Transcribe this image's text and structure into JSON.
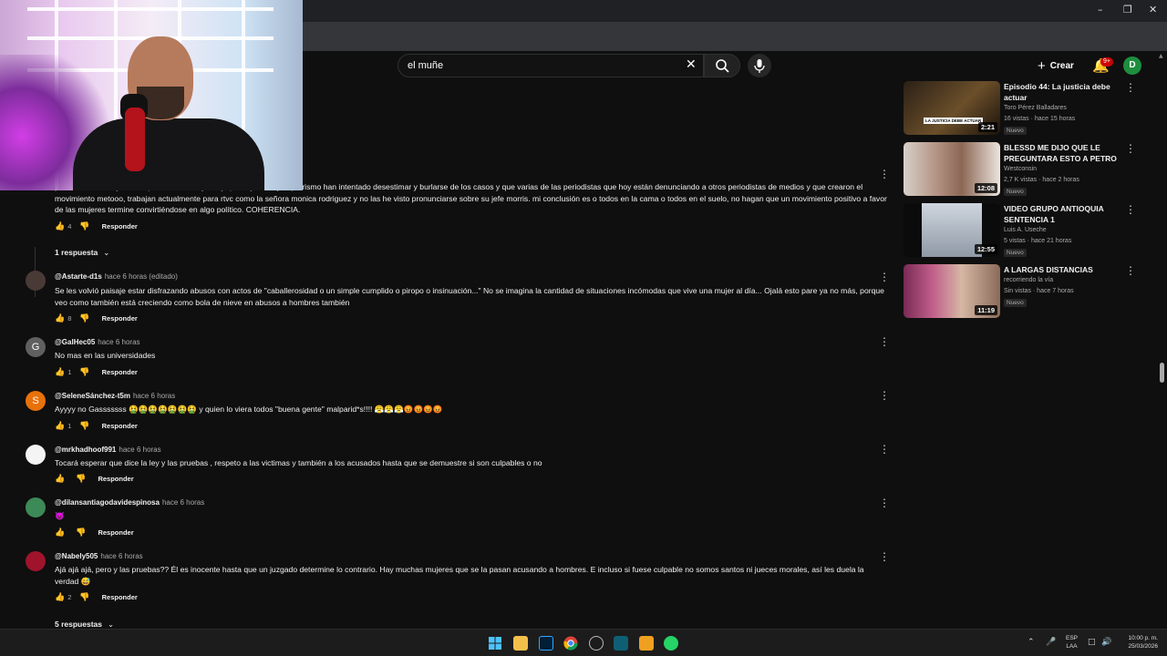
{
  "search": {
    "query": "el muñe"
  },
  "header": {
    "create_label": "Crear",
    "notif_badge": "9+",
    "user_initial": "D"
  },
  "comments": [
    {
      "text": "por acoso sexual y laboral por muchas mujeres y que la justicia y el petrismo han intentado desestimar y burlarse de los casos y que varias de las periodistas que hoy están denunciando a otros periodistas de medios y que crearon el movimiento metooo, trabajan actualmente para rtvc como la señora monica rodriguez y no las he visto pronunciarse sobre su jefe morris. mi conclusión es o todos en la cama o todos en el suelo, no hagan que un movimiento positivo a favor de las mujeres termine convirtiéndose en algo político. COHERENCIA.",
      "likes": "4",
      "reply_label": "Responder"
    },
    {
      "author": "@Astarte-d1s",
      "time": "hace 6 horas (editado)",
      "text": "Se les volvió paisaje estar disfrazando abusos con actos de \"caballerosidad o un simple cumplido o piropo o insinuación...\"  No se imagina la cantidad de situaciones incómodas que vive una mujer al día... Ojalá esto pare ya no más, porque veo como también está creciendo como bola de nieve en abusos a hombres también",
      "likes": "8",
      "reply_label": "Responder"
    },
    {
      "author": "@GalHec05",
      "time": "hace 6 horas",
      "text": "No mas en las universidades",
      "likes": "1",
      "reply_label": "Responder",
      "avatar_letter": "G"
    },
    {
      "author": "@SeleneSánchez-t5m",
      "time": "hace 6 horas",
      "text": "Ayyyy no Gasssssss 🤮🤮🤮🤮🤮🤮🤮 y quien lo viera todos \"buena gente\" malparid*s!!!! 😤😤😤😡😡😡😡",
      "likes": "1",
      "reply_label": "Responder",
      "avatar_letter": "S"
    },
    {
      "author": "@mrkhadhoof991",
      "time": "hace 6 horas",
      "text": "Tocará esperar que dice la ley y las pruebas , respeto a las victimas y también a los acusados hasta que se demuestre si son culpables o no",
      "reply_label": "Responder"
    },
    {
      "author": "@dilansantiagodavidespinosa",
      "time": "hace 6 horas",
      "text": "👿",
      "reply_label": "Responder"
    },
    {
      "author": "@Nabely505",
      "time": "hace 6 horas",
      "text": "Ajá ajá ajá, pero y las pruebas?? Él es inocente hasta que un juzgado determine lo contrario. Hay muchas mujeres que se la pasan acusando a hombres. E incluso si fuese culpable no somos santos ni jueces morales, así les duela la verdad 😅",
      "likes": "2",
      "reply_label": "Responder"
    }
  ],
  "replies": [
    {
      "label": "1 respuesta"
    },
    {
      "label": "5 respuestas"
    }
  ],
  "sidebar": [
    {
      "title": "Episodio 44: La justicia debe actuar",
      "channel": "Toro Pérez Balladares",
      "views": "16 vistas · hace 15 horas",
      "badge": "Nuevo",
      "duration": "2:21",
      "thumb_text": "LA JUSTICIA DEBE ACTUAR"
    },
    {
      "title": "BLESSD ME DIJO QUE LE PREGUNTARA ESTO A PETRO ...",
      "channel": "Westconsin",
      "views": "2,7 K vistas · hace 2 horas",
      "badge": "Nuevo",
      "duration": "12:08"
    },
    {
      "title": "VIDEO GRUPO ANTIOQUIA SENTENCIA 1",
      "channel": "Luis A. Useche",
      "views": "5 vistas · hace 21 horas",
      "badge": "Nuevo",
      "duration": "12:55"
    },
    {
      "title": "A LARGAS DISTANCIAS",
      "channel": "recorriendo la vía",
      "views": "Sin vistas · hace 7 horas",
      "badge": "Nuevo",
      "duration": "11:19"
    }
  ],
  "taskbar": {
    "lang_top": "ESP",
    "lang_bottom": "LAA",
    "time": "10:00 p. m.",
    "date": "25/03/2026"
  },
  "colors": {
    "accent_red": "#cc0000",
    "avatar_green": "#1e8e3e",
    "avatar_orange": "#e8710a",
    "avatar_grey": "#606060"
  },
  "icons": [
    "minimize-icon",
    "maximize-icon",
    "close-icon",
    "search-icon",
    "mic-icon",
    "bell-icon",
    "like-icon",
    "dislike-icon",
    "more-vert-icon",
    "chevron-down-icon",
    "windows-start-icon",
    "folder-icon",
    "photoshop-icon",
    "chrome-icon",
    "whatsapp-icon"
  ]
}
